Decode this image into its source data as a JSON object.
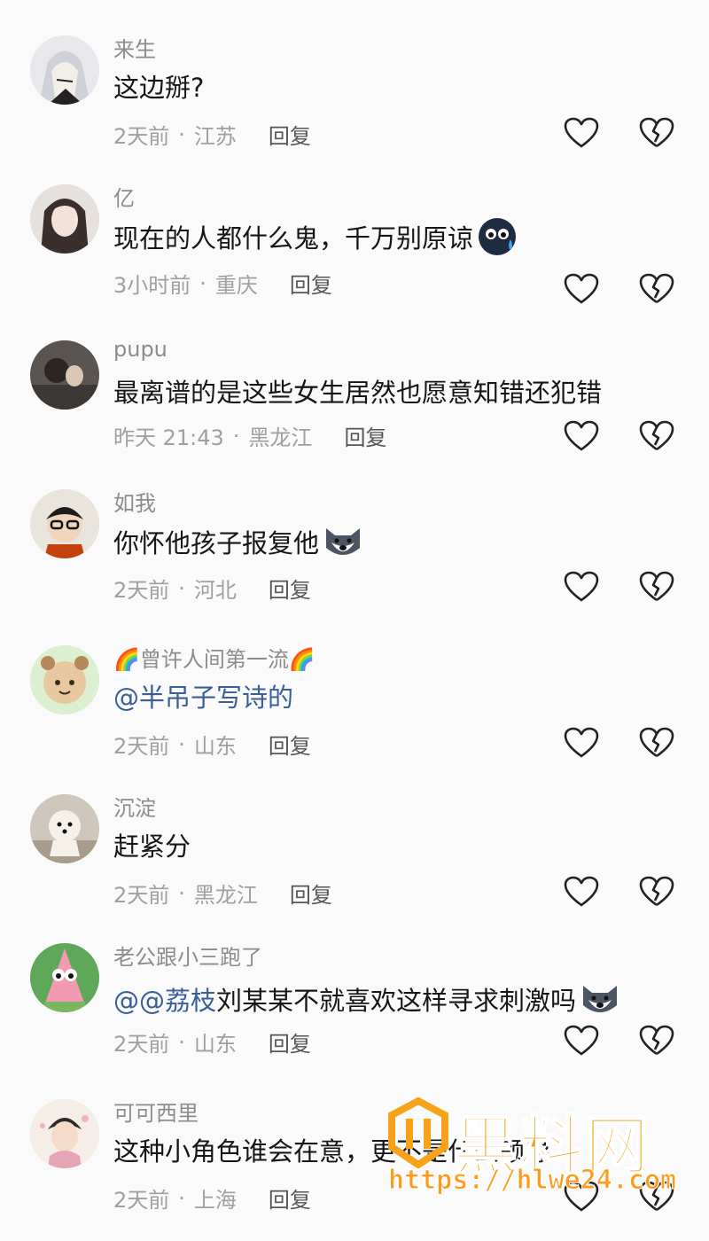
{
  "comments": [
    {
      "name": "来生",
      "text": "这边掰?",
      "time": "2天前",
      "location": "江苏",
      "reply": "回复"
    },
    {
      "name": "亿",
      "text": "现在的人都什么鬼，千万别原谅",
      "time": "3小时前",
      "location": "重庆",
      "reply": "回复"
    },
    {
      "name": "pupu",
      "text": "最离谱的是这些女生居然也愿意知错还犯错",
      "time": "昨天 21:43",
      "location": "黑龙江",
      "reply": "回复"
    },
    {
      "name": "如我",
      "text": "你怀他孩子报复他",
      "time": "2天前",
      "location": "河北",
      "reply": "回复"
    },
    {
      "name": "🌈曾许人间第一流🌈",
      "mention": "@半吊子写诗的",
      "text": "",
      "time": "2天前",
      "location": "山东",
      "reply": "回复"
    },
    {
      "name": "沉淀",
      "text": "赶紧分",
      "time": "2天前",
      "location": "黑龙江",
      "reply": "回复"
    },
    {
      "name": "老公跟小三跑了",
      "mention": "@@荔枝",
      "text": " 刘某某不就喜欢这样寻求刺激吗",
      "time": "2天前",
      "location": "山东",
      "reply": "回复"
    },
    {
      "name": "可可西里",
      "text": "这种小角色谁会在意，更不是什么领导",
      "time": "2天前",
      "location": "上海",
      "reply": "回复"
    }
  ],
  "watermark": {
    "title": "黑料网",
    "url": "https://hlwe24.com"
  },
  "colors": {
    "mention": "#3a5e9a",
    "meta": "#a0a0a0",
    "watermark": "#f7a31a"
  }
}
